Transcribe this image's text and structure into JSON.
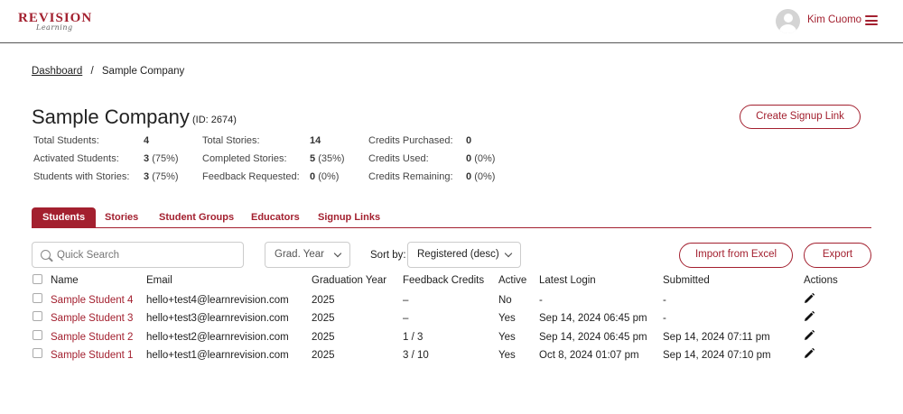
{
  "header": {
    "logo_main": "REVISION",
    "logo_sub": "Learning",
    "user_name": "Kim Cuomo"
  },
  "breadcrumb": {
    "home": "Dashboard",
    "separator": "/",
    "current": "Sample Company"
  },
  "company": {
    "name": "Sample Company",
    "id_text": "(ID: 2674)",
    "create_signup_label": "Create Signup Link"
  },
  "stats": {
    "total_students_label": "Total Students:",
    "total_students": "4",
    "activated_label": "Activated Students:",
    "activated": "3",
    "activated_pct": "(75%)",
    "with_stories_label": "Students with Stories:",
    "with_stories": "3",
    "with_stories_pct": "(75%)",
    "total_stories_label": "Total Stories:",
    "total_stories": "14",
    "completed_label": "Completed Stories:",
    "completed": "5",
    "completed_pct": "(35%)",
    "feedback_label": "Feedback Requested:",
    "feedback": "0",
    "feedback_pct": "(0%)",
    "credits_purchased_label": "Credits Purchased:",
    "credits_purchased": "0",
    "credits_used_label": "Credits Used:",
    "credits_used": "0",
    "credits_used_pct": "(0%)",
    "credits_remaining_label": "Credits Remaining:",
    "credits_remaining": "0",
    "credits_remaining_pct": "(0%)"
  },
  "tabs": [
    "Students",
    "Stories",
    "Student Groups",
    "Educators",
    "Signup Links"
  ],
  "toolbar": {
    "search_placeholder": "Quick Search",
    "grad_year": "Grad. Year",
    "sort_by_label": "Sort by:",
    "sort_value": "Registered (desc)",
    "import_label": "Import from Excel",
    "export_label": "Export"
  },
  "table": {
    "columns": [
      "Name",
      "Email",
      "Graduation Year",
      "Feedback Credits",
      "Active",
      "Latest Login",
      "Submitted",
      "Actions"
    ],
    "rows": [
      {
        "name": "Sample Student 4",
        "email": "hello+test4@learnrevision.com",
        "year": "2025",
        "credits": "–",
        "active": "No",
        "login": "-",
        "submitted": "-"
      },
      {
        "name": "Sample Student 3",
        "email": "hello+test3@learnrevision.com",
        "year": "2025",
        "credits": "–",
        "active": "Yes",
        "login": "Sep 14, 2024 06:45 pm",
        "submitted": "-"
      },
      {
        "name": "Sample Student 2",
        "email": "hello+test2@learnrevision.com",
        "year": "2025",
        "credits": "1 / 3",
        "active": "Yes",
        "login": "Sep 14, 2024 06:45 pm",
        "submitted": "Sep 14, 2024 07:11 pm"
      },
      {
        "name": "Sample Student 1",
        "email": "hello+test1@learnrevision.com",
        "year": "2025",
        "credits": "3 / 10",
        "active": "Yes",
        "login": "Oct 8, 2024 01:07 pm",
        "submitted": "Sep 14, 2024 07:10 pm"
      }
    ]
  },
  "colors": {
    "accent": "#a3202f"
  }
}
